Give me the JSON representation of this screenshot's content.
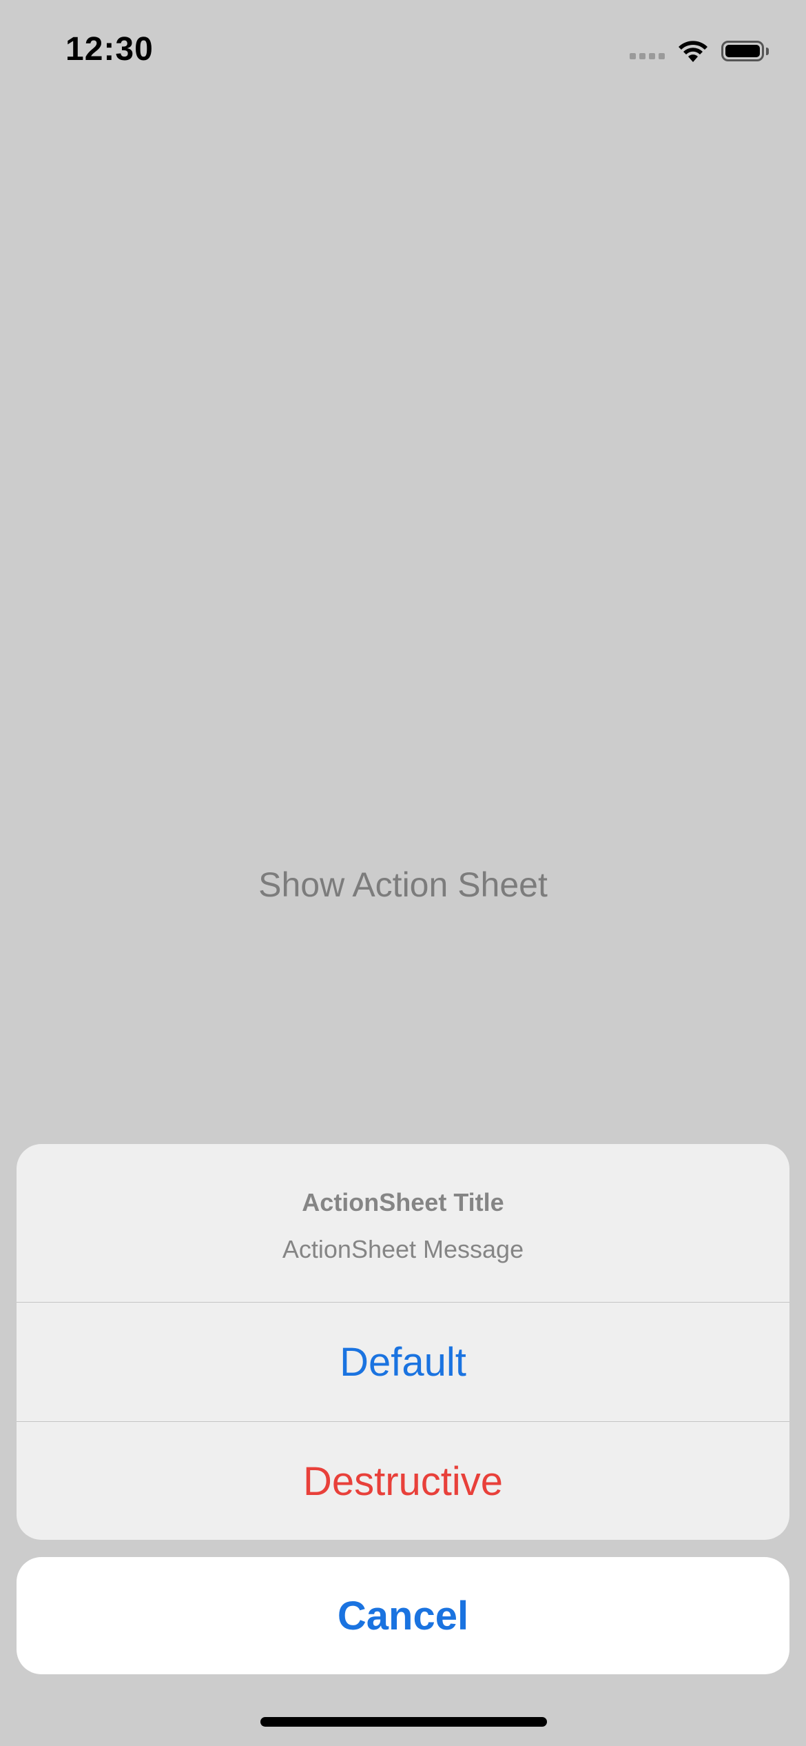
{
  "status_bar": {
    "time": "12:30",
    "icons": [
      "cellular-signal-icon",
      "wifi-icon",
      "battery-icon"
    ]
  },
  "main": {
    "show_button_label": "Show Action Sheet"
  },
  "action_sheet": {
    "title": "ActionSheet Title",
    "message": "ActionSheet Message",
    "actions": [
      {
        "label": "Default",
        "style": "default"
      },
      {
        "label": "Destructive",
        "style": "destructive"
      }
    ],
    "cancel_label": "Cancel"
  },
  "colors": {
    "accent": "#1a73e0",
    "destructive": "#e8403a",
    "dimmed_background": "#cccccc"
  }
}
